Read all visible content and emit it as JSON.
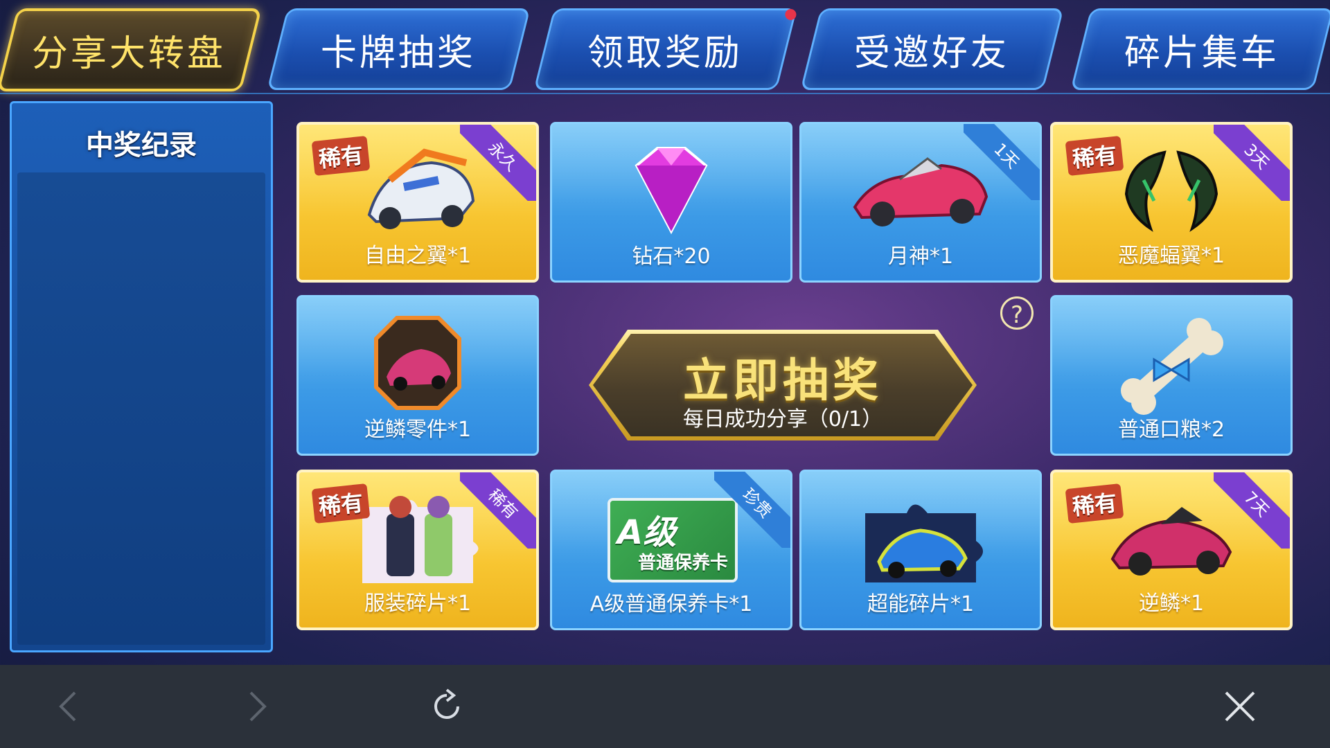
{
  "tabs": [
    {
      "label": "分享大转盘",
      "active": true
    },
    {
      "label": "卡牌抽奖"
    },
    {
      "label": "领取奖励",
      "has_dot": true
    },
    {
      "label": "受邀好友"
    },
    {
      "label": "碎片集车"
    }
  ],
  "records": {
    "title": "中奖纪录"
  },
  "rare_label": "稀有",
  "prizes": [
    {
      "label": "自由之翼*1",
      "style": "gold",
      "rare": true,
      "ribbon": "永久",
      "icon": "winged-car-icon"
    },
    {
      "label": "钻石*20",
      "style": "blue",
      "icon": "diamond-icon"
    },
    {
      "label": "月神*1",
      "style": "blue",
      "ribbon": "1天",
      "icon": "red-convertible-icon"
    },
    {
      "label": "恶魔蝠翼*1",
      "style": "gold",
      "rare": true,
      "ribbon": "3天",
      "icon": "bat-wings-icon"
    },
    {
      "label": "逆鳞零件*1",
      "style": "blue",
      "icon": "car-part-icon"
    },
    {
      "label": "普通口粮*2",
      "style": "blue",
      "icon": "bone-icon"
    },
    {
      "label": "服装碎片*1",
      "style": "gold",
      "rare": true,
      "ribbon": "稀有",
      "icon": "costume-puzzle-icon"
    },
    {
      "label": "A级普通保养卡*1",
      "style": "blue",
      "ribbon": "珍贵",
      "icon": "maintenance-card-icon"
    },
    {
      "label": "超能碎片*1",
      "style": "blue",
      "icon": "car-puzzle-icon"
    },
    {
      "label": "逆鳞*1",
      "style": "gold",
      "rare": true,
      "ribbon": "7天",
      "icon": "pink-supercar-icon"
    }
  ],
  "maintenance_card": {
    "grade": "A级",
    "name": "普通保养卡"
  },
  "draw": {
    "title": "立即抽奖",
    "subtitle": "每日成功分享（0/1）",
    "help_symbol": "?"
  },
  "bottom_nav": {
    "back": "back-icon",
    "forward": "forward-icon",
    "refresh": "refresh-icon",
    "close": "close-icon"
  }
}
